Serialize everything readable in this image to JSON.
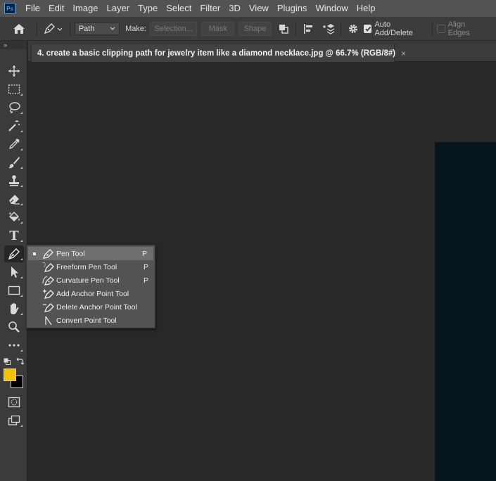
{
  "app": {
    "logo_text": "Ps"
  },
  "menu": [
    "File",
    "Edit",
    "Image",
    "Layer",
    "Type",
    "Select",
    "Filter",
    "3D",
    "View",
    "Plugins",
    "Window",
    "Help"
  ],
  "options": {
    "mode_value": "Path",
    "make_label": "Make:",
    "selection_button": "Selection...",
    "mask_button": "Mask",
    "shape_button": "Shape",
    "auto_add_delete": {
      "label": "Auto Add/Delete",
      "checked": true
    },
    "align_edges": {
      "label": "Align Edges",
      "checked": false
    }
  },
  "document": {
    "tab_title": "4. create a basic clipping path for jewelry item like a diamond necklace.jpg @ 66.7% (RGB/8#)",
    "close_glyph": "×"
  },
  "toolbar": {
    "collapse_glyph": "»",
    "tools": [
      {
        "name": "move-tool",
        "icon": "move-icon"
      },
      {
        "name": "marquee-tool",
        "icon": "marquee-icon"
      },
      {
        "name": "lasso-tool",
        "icon": "lasso-icon"
      },
      {
        "name": "magic-wand-tool",
        "icon": "magic-wand-icon"
      },
      {
        "name": "eyedropper-tool",
        "icon": "eyedropper-icon"
      },
      {
        "name": "brush-tool",
        "icon": "brush-icon"
      },
      {
        "name": "stamp-tool",
        "icon": "stamp-icon"
      },
      {
        "name": "eraser-tool",
        "icon": "eraser-icon"
      },
      {
        "name": "paint-bucket-tool",
        "icon": "paint-bucket-icon"
      },
      {
        "name": "type-tool",
        "icon": "type-icon"
      },
      {
        "name": "pen-tool",
        "icon": "pen-icon"
      },
      {
        "name": "path-selection-tool",
        "icon": "arrow-icon"
      },
      {
        "name": "rectangle-tool",
        "icon": "rectangle-icon"
      },
      {
        "name": "hand-tool",
        "icon": "hand-icon"
      },
      {
        "name": "zoom-tool",
        "icon": "zoom-icon"
      },
      {
        "name": "more-tools",
        "icon": "ellipsis-icon"
      }
    ],
    "foreground_color": "#f5c000",
    "background_color": "#000000",
    "type_tool_glyph": "T"
  },
  "pen_flyout": {
    "items": [
      {
        "label": "Pen Tool",
        "key": "P",
        "selected": true,
        "icon": "pen-icon"
      },
      {
        "label": "Freeform Pen Tool",
        "key": "P",
        "selected": false,
        "icon": "freeform-pen-icon"
      },
      {
        "label": "Curvature Pen Tool",
        "key": "P",
        "selected": false,
        "icon": "curvature-pen-icon"
      },
      {
        "label": "Add Anchor Point Tool",
        "key": "",
        "selected": false,
        "icon": "add-anchor-point-icon"
      },
      {
        "label": "Delete Anchor Point Tool",
        "key": "",
        "selected": false,
        "icon": "delete-anchor-point-icon"
      },
      {
        "label": "Convert Point Tool",
        "key": "",
        "selected": false,
        "icon": "convert-point-icon"
      }
    ]
  },
  "colors": {
    "menubar": "#535353",
    "panel": "#3b3b3b",
    "canvas": "#282828",
    "document_image": "#06141d"
  }
}
